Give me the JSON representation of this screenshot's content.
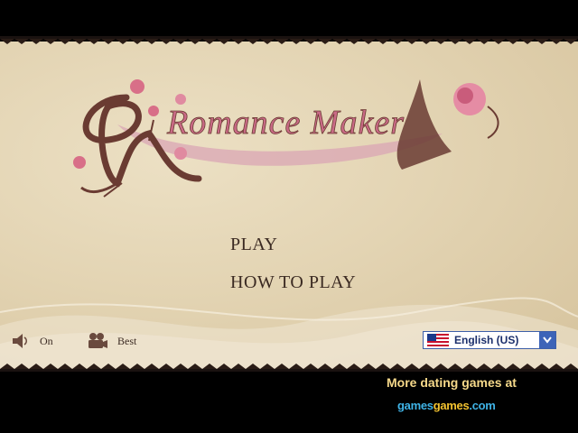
{
  "game": {
    "title": "Romance Maker"
  },
  "menu": {
    "play_label": "PLAY",
    "how_to_play_label": "HOW TO PLAY"
  },
  "controls": {
    "sound_label": "On",
    "sound_icon": "speaker-icon",
    "quality_label": "Best",
    "quality_icon": "camera-icon"
  },
  "language": {
    "selected": "English (US)",
    "flag_icon": "us-flag-icon"
  },
  "promo": {
    "text": "More dating games at",
    "site_parts": [
      "games",
      "games",
      ".com"
    ]
  },
  "colors": {
    "parchment": "#e3d4b3",
    "title_pink": "#c96a86",
    "title_brown": "#6a3b32",
    "promo_gold": "#f6d98a"
  }
}
